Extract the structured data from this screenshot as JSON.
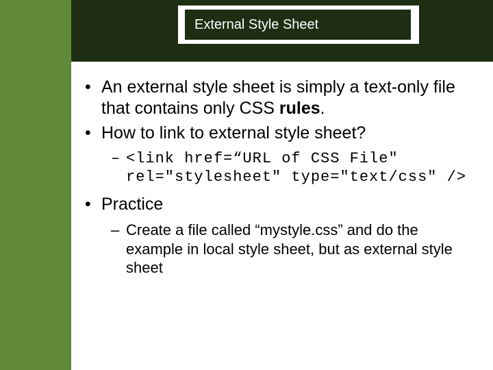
{
  "slide": {
    "title": "External Style Sheet",
    "bullets": {
      "b1_part1": "An external style sheet is simply a text-only file that contains only CSS ",
      "b1_bold": "rules",
      "b1_part2": ".",
      "b2": "How to link to external style sheet?",
      "b2_sub1": "<link href=“URL of CSS File\" rel=\"stylesheet\" type=\"text/css\" />",
      "b3": "Practice",
      "b3_sub1": "Create a file called “mystyle.css” and do the example in local style sheet, but as external style sheet"
    }
  }
}
